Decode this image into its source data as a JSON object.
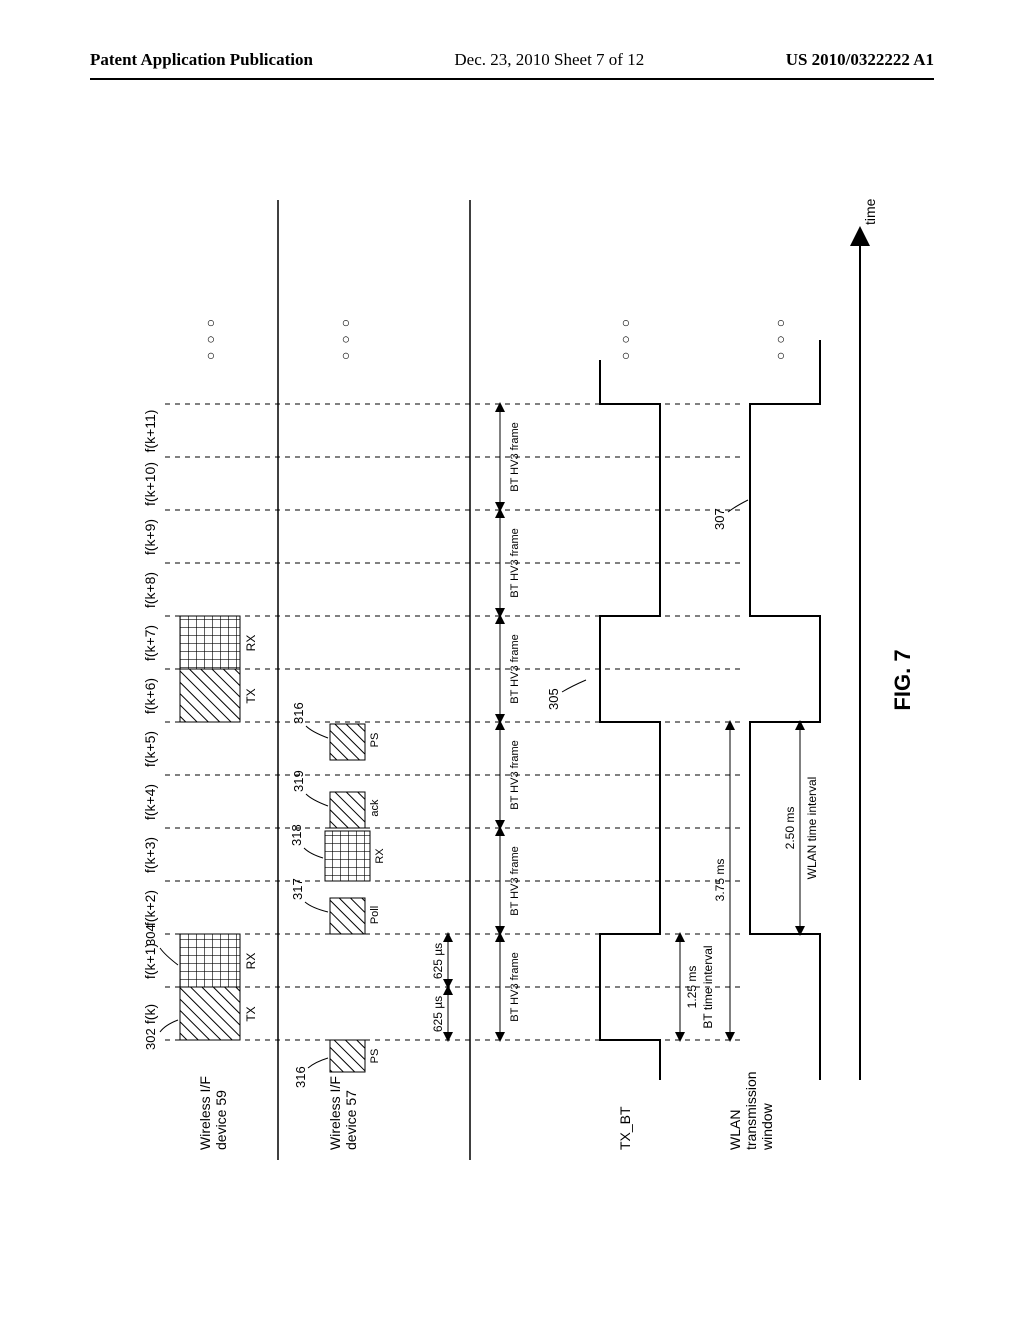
{
  "header": {
    "left": "Patent Application Publication",
    "middle": "Dec. 23, 2010  Sheet 7 of 12",
    "right": "US 2010/0322222 A1"
  },
  "figure": {
    "caption": "FIG. 7",
    "freq_labels": [
      "f(k)",
      "f(k+1)",
      "f(k+2)",
      "f(k+3)",
      "f(k+4)",
      "f(k+5)",
      "f(k+6)",
      "f(k+7)",
      "f(k+8)",
      "f(k+9)",
      "f(k+10)",
      "f(k+11)"
    ],
    "row_labels": {
      "wireless_if_59": "Wireless I/F\ndevice 59",
      "wireless_if_57": "Wireless I/F\ndevice 57",
      "tx_bt": "TX_BT",
      "wlan_window": "WLAN\ntransmission\nwindow"
    },
    "refs": {
      "r302": "302",
      "r304": "304",
      "r316a": "316",
      "r316b": "316",
      "r317": "317",
      "r318": "318",
      "r319": "319",
      "r305": "305",
      "r307": "307"
    },
    "slot_labels": {
      "tx": "TX",
      "rx": "RX",
      "ps": "PS",
      "poll": "Poll",
      "ack": "ack"
    },
    "timing": {
      "slot625a": "625 µs",
      "slot625b": "625 µs",
      "bt_hv3": "BT HV3 frame",
      "bt_interval_label": "BT time interval",
      "bt_interval_val": "1.25 ms",
      "wlan_interval_label": "WLAN time interval",
      "wlan_interval_val": "2.50 ms",
      "total_interval": "3.75 ms",
      "time_axis": "time"
    },
    "ellipsis": "○ ○ ○"
  }
}
